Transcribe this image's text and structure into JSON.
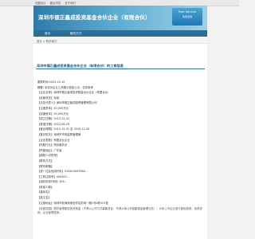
{
  "topbar": {
    "links": [
      "加盟创业",
      "最近浏览",
      "关于我们"
    ]
  },
  "header": {
    "title": "深圳市德正鑫成投资基金合伙企业（有限合伙）",
    "badge_line1": "Free Service",
    "badge_line2": "免费咨询"
  },
  "nav": {
    "items": [
      "首页",
      "服务方式"
    ]
  },
  "subbar": {
    "crumb": "首页 > 联系我们",
    "date": ""
  },
  "section": {
    "title": "深圳市德正鑫成投资基金合伙企业（有限合伙）的工商信息"
  },
  "info": [
    "更新时间:2023-10-10",
    "摘要: 本页为企业工商登记信息公示，仅供参考",
    "【企业名称】深圳市德正鑫成投资基金合伙企业（有限合伙）",
    "【经营状态】存续",
    "【法定代表人】深圳市德正鑫成投资管理有限公司",
    "【注册资本】50,000万元",
    "【实缴资本】50,000万元",
    "【成立日期】2015-12-31",
    "【核准日期】2022-06-29",
    "【营业期限】2015-12-31 至 2035-12-30",
    "【登记机关】深圳市市场监督管理局",
    "【企业类型】有限合伙企业",
    "【所属行业】商务服务业",
    "【所属地区】广东省",
    "【纳税人识别号】",
    "【联系方式】",
    "【联系邮箱】",
    "【统一社会信用代码】914403003584...",
    "【工商注册号】440300...",
    "【组织机构代码】358...",
    "【参保人数】",
    "【曾用名】",
    "【英文名】",
    "【注册地址】深圳市前海深港合作区前湾一路1号A栋201室"
  ],
  "paragraph": "【经营范围】受托管理股权投资基金（不得以公开方式募集资金，不得从事公开募集基金管理业务）；对未上市企业进行股权投资；投资咨询；企业管理咨询。"
}
